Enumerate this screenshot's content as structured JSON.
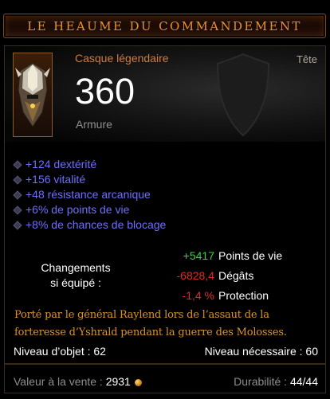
{
  "title": "LE HEAUME DU COMMANDEMENT",
  "item_type": "Casque légendaire",
  "slot": "Tête",
  "armor": {
    "value": "360",
    "label": "Armure"
  },
  "stats": [
    "+124 dextérité",
    "+156 vitalité",
    "+48 résistance arcanique",
    "+6% de points de vie",
    "+8% de chances de blocage"
  ],
  "changes": {
    "label_line1": "Changements",
    "label_line2": "si équipé :",
    "rows": [
      {
        "value": "+5417",
        "label": "Points de vie",
        "color": "#3cd23c"
      },
      {
        "value": "-6828,4",
        "label": "Dégâts",
        "color": "#e02a2a"
      },
      {
        "value": "-1,4 %",
        "label": "Protection",
        "color": "#e02a2a"
      }
    ]
  },
  "flavor": {
    "line1": "Porté par le général Raylend lors de l’assaut de la",
    "line2": "forteresse d’Yshrald pendant la guerre des Molosses."
  },
  "item_level": "Niveau d’objet : 62",
  "required_level": "Niveau nécessaire : 60",
  "sell_label": "Valeur à la vente : ",
  "sell_value": "2931",
  "durability_label": "Durabilité : ",
  "durability_value": "44/44",
  "icons": {
    "item": "legendary-helm-icon",
    "currency": "gold-coin-icon",
    "bullet": "affix-diamond-icon"
  },
  "colors": {
    "title": "#e8902a",
    "legendary": "#d67a3a",
    "affix": "#6e6eff",
    "flavor": "#d8952a"
  }
}
